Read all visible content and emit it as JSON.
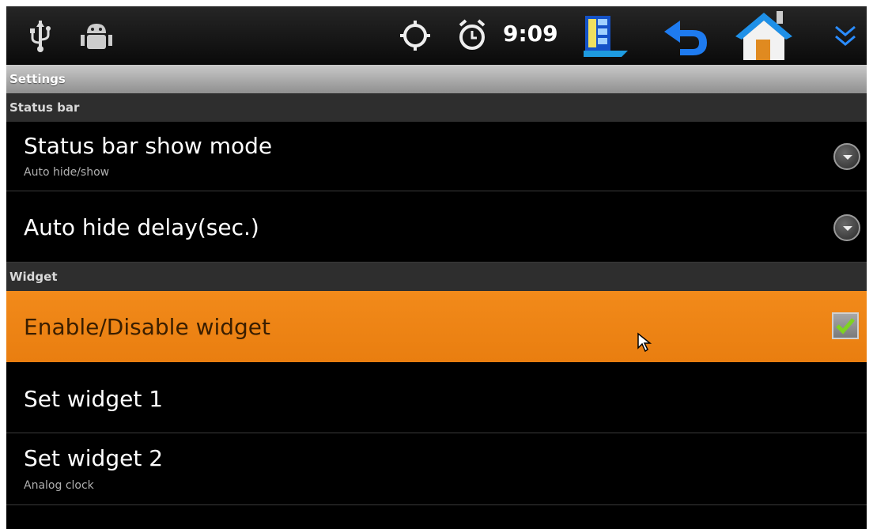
{
  "statusbar": {
    "left_icons": [
      "usb-icon",
      "android-debug-icon"
    ],
    "right_icons": [
      "gps-icon",
      "alarm-icon",
      "clock",
      "screen-icon",
      "back-icon",
      "home-icon",
      "expand-icon"
    ],
    "time": "9:09"
  },
  "title": "Settings",
  "categories": {
    "status_bar": "Status bar",
    "widget": "Widget"
  },
  "prefs": {
    "status_bar_show_mode": {
      "title": "Status bar show mode",
      "summary": "Auto hide/show"
    },
    "auto_hide_delay": {
      "title": "Auto hide delay(sec.)"
    },
    "enable_widget": {
      "title": "Enable/Disable widget",
      "checked": true
    },
    "set_widget_1": {
      "title": "Set widget 1"
    },
    "set_widget_2": {
      "title": "Set widget 2",
      "summary": "Analog clock"
    }
  },
  "colors": {
    "selected_row": "#f28a1a",
    "check": "#7ed321",
    "back_arrow": "#1e7bf0",
    "expand": "#2a8cff"
  }
}
